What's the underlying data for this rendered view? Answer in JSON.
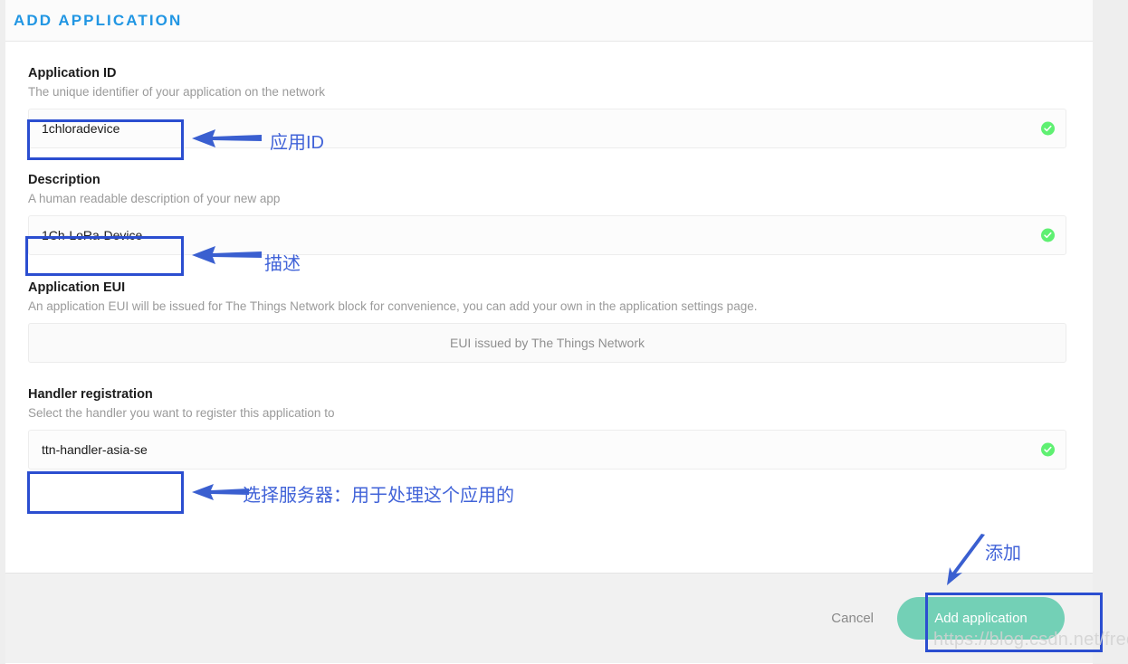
{
  "header": {
    "title": "ADD APPLICATION",
    "title_color": "#2196e3"
  },
  "fields": [
    {
      "label": "Application ID",
      "description": "The unique identifier of your application on the network",
      "value": "1chloradevice",
      "valid": true
    },
    {
      "label": "Description",
      "description": "A human readable description of your new app",
      "value": "1Ch-LoRa-Device",
      "valid": true
    },
    {
      "label": "Application EUI",
      "description": "An application EUI will be issued for The Things Network block for convenience, you can add your own in the application settings page.",
      "value": "EUI issued by The Things Network",
      "valid": false
    },
    {
      "label": "Handler registration",
      "description": "Select the handler you want to register this application to",
      "value": "ttn-handler-asia-se",
      "valid": true
    }
  ],
  "annotations": {
    "color": "#4163d8",
    "box_color": "#2b4ed0",
    "application_id": "应用ID",
    "description": "描述",
    "handler": "选择服务器：用于处理这个应用的",
    "add": "添加"
  },
  "footer": {
    "cancel_label": "Cancel",
    "submit_label": "Add application",
    "submit_color": "#73d0b6"
  },
  "watermark": "https://blog.csdn.net/freemote"
}
